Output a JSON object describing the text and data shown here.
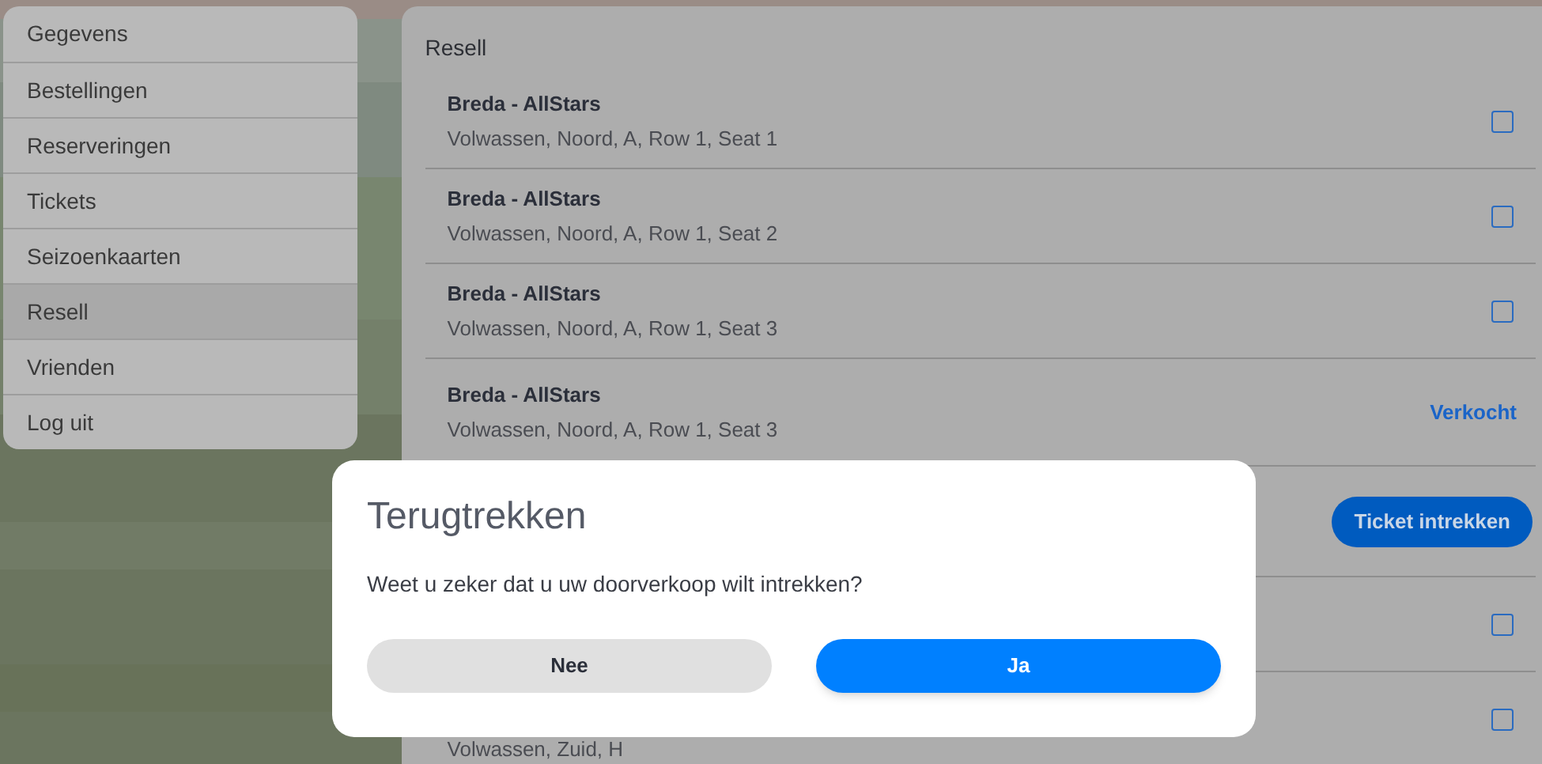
{
  "sidebar": {
    "items": [
      {
        "label": "Gegevens",
        "selected": false
      },
      {
        "label": "Bestellingen",
        "selected": false
      },
      {
        "label": "Reserveringen",
        "selected": false
      },
      {
        "label": "Tickets",
        "selected": false
      },
      {
        "label": "Seizoenkaarten",
        "selected": false
      },
      {
        "label": "Resell",
        "selected": true
      },
      {
        "label": "Vrienden",
        "selected": false
      },
      {
        "label": "Log uit",
        "selected": false
      }
    ]
  },
  "panel": {
    "title": "Resell",
    "rows": [
      {
        "title": "Breda - AllStars",
        "subtitle": "Volwassen, Noord, A, Row 1, Seat 1",
        "kind": "checkbox",
        "checked": false
      },
      {
        "title": "Breda - AllStars",
        "subtitle": "Volwassen, Noord, A, Row 1, Seat 2",
        "kind": "checkbox",
        "checked": false
      },
      {
        "title": "Breda - AllStars",
        "subtitle": "Volwassen, Noord, A, Row 1, Seat 3",
        "kind": "checkbox",
        "checked": false
      },
      {
        "title": "Breda - AllStars",
        "subtitle": "Volwassen, Noord, A, Row 1, Seat 3",
        "kind": "status",
        "status": "Verkocht"
      },
      {
        "kind": "action",
        "action": "Ticket intrekken"
      },
      {
        "kind": "checkbox",
        "checked": false
      },
      {
        "subtitle": "Volwassen, Zuid, H",
        "kind": "checkbox",
        "checked": false
      }
    ]
  },
  "dialog": {
    "title": "Terugtrekken",
    "message": "Weet u zeker dat u uw doorverkoop wilt intrekken?",
    "buttons": [
      {
        "label": "Nee",
        "kind": "secondary"
      },
      {
        "label": "Ja",
        "kind": "primary"
      }
    ]
  }
}
